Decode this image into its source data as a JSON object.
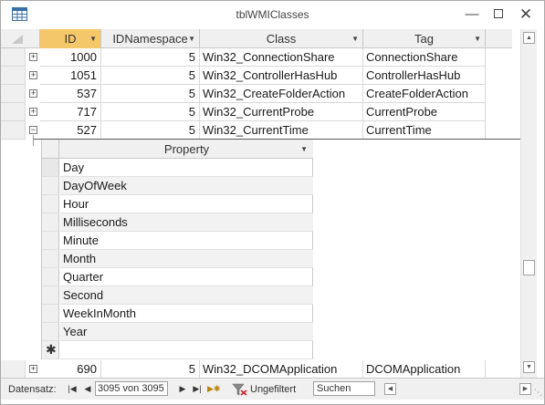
{
  "window": {
    "title": "tblWMIClasses"
  },
  "columns": {
    "id": "ID",
    "idnamespace": "IDNamespace",
    "class": "Class",
    "tag": "Tag"
  },
  "rows": [
    {
      "id": "1000",
      "ns": "5",
      "cls": "Win32_ConnectionShare",
      "tag": "ConnectionShare",
      "expander": "+"
    },
    {
      "id": "1051",
      "ns": "5",
      "cls": "Win32_ControllerHasHub",
      "tag": "ControllerHasHub",
      "expander": "+"
    },
    {
      "id": "537",
      "ns": "5",
      "cls": "Win32_CreateFolderAction",
      "tag": "CreateFolderAction",
      "expander": "+"
    },
    {
      "id": "717",
      "ns": "5",
      "cls": "Win32_CurrentProbe",
      "tag": "CurrentProbe",
      "expander": "+"
    },
    {
      "id": "527",
      "ns": "5",
      "cls": "Win32_CurrentTime",
      "tag": "CurrentTime",
      "expander": "−"
    }
  ],
  "subdatasheet": {
    "header": "Property",
    "items": [
      "Day",
      "DayOfWeek",
      "Hour",
      "Milliseconds",
      "Minute",
      "Month",
      "Quarter",
      "Second",
      "WeekInMonth",
      "Year"
    ],
    "new_row_marker": "✱"
  },
  "last_row": {
    "id": "690",
    "ns": "5",
    "cls": "Win32_DCOMApplication",
    "tag": "DCOMApplication",
    "expander": "+"
  },
  "navigation": {
    "label": "Datensatz:",
    "record": "3095 von 3095",
    "filter_label": "Ungefiltert",
    "search_label": "Suchen"
  }
}
